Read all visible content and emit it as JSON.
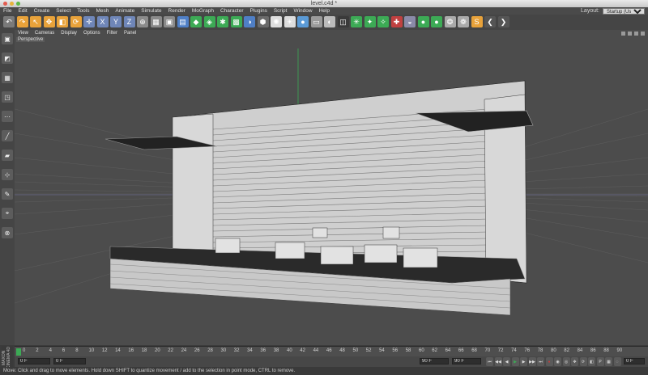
{
  "window": {
    "title": "level.c4d *"
  },
  "menu": [
    "File",
    "Edit",
    "Create",
    "Select",
    "Tools",
    "Mesh",
    "Animate",
    "Simulate",
    "Render",
    "MoGraph",
    "Character",
    "Plugins",
    "Script",
    "Window",
    "Help"
  ],
  "layout": {
    "label": "Layout:",
    "value": "Startup (User)"
  },
  "toolbar_icons": [
    "undo-icon",
    "redo-icon",
    "live-select-icon",
    "move-icon",
    "scale-icon",
    "rotate-icon",
    "recent-tool-icon",
    "x-axis-icon",
    "y-axis-icon",
    "z-axis-icon",
    "coordinate-system-icon",
    "render-region-icon",
    "render-view-icon",
    "render-settings-icon",
    "cube-icon",
    "bend-icon",
    "subdivision-icon",
    "array-icon",
    "spline-icon",
    "nurbs-icon",
    "light-icon",
    "camera-icon",
    "sky-icon",
    "floor-icon",
    "display-icon",
    "texture-icon",
    "mograph-icon",
    "cloner-icon",
    "tracer-icon",
    "effector-icon",
    "deformer-icon",
    "sphere-icon",
    "cylinder-icon",
    "hair-icon",
    "sculpt-icon",
    "script-s-icon",
    "prev-arrow-icon",
    "next-arrow-icon"
  ],
  "left_icons": [
    "object-mode-icon",
    "model-mode-icon",
    "texture-mode-icon",
    "workplane-icon",
    "points-mode-icon",
    "edges-mode-icon",
    "polygons-mode-icon",
    "axis-mode-icon",
    "tweak-icon",
    "snap-icon",
    "magnet-icon"
  ],
  "viewport": {
    "menu": [
      "View",
      "Cameras",
      "Display",
      "Options",
      "Filter",
      "Panel"
    ],
    "label": "Perspective"
  },
  "timeline": {
    "ticks": [
      "0",
      "2",
      "4",
      "6",
      "8",
      "10",
      "12",
      "14",
      "16",
      "18",
      "20",
      "22",
      "24",
      "26",
      "28",
      "30",
      "32",
      "34",
      "36",
      "38",
      "40",
      "42",
      "44",
      "46",
      "48",
      "50",
      "52",
      "54",
      "56",
      "58",
      "60",
      "62",
      "64",
      "66",
      "68",
      "70",
      "72",
      "74",
      "76",
      "78",
      "80",
      "82",
      "84",
      "86",
      "88",
      "90"
    ],
    "current_frame": "0 F"
  },
  "controls": {
    "start": "0 F",
    "start2": "0 F",
    "end": "90 F",
    "end2": "90 F",
    "buttons": [
      "first-frame-icon",
      "prev-key-icon",
      "prev-frame-icon",
      "play-icon",
      "next-frame-icon",
      "next-key-icon",
      "last-frame-icon",
      "record-icon",
      "autokey-icon",
      "keyframe-selection-icon",
      "position-key-icon",
      "rotation-key-icon",
      "scale-key-icon",
      "param-key-icon",
      "pla-key-icon",
      "motion-icon"
    ]
  },
  "status": "Move: Click and drag to move elements. Hold down SHIFT to quantize movement / add to the selection in point mode, CTRL to remove.",
  "brand": "MAXON CINEMA 4D",
  "colors": {
    "accent": "#e8a23a",
    "blue": "#4f7fc6",
    "green": "#3caa55",
    "red": "#c04040"
  }
}
